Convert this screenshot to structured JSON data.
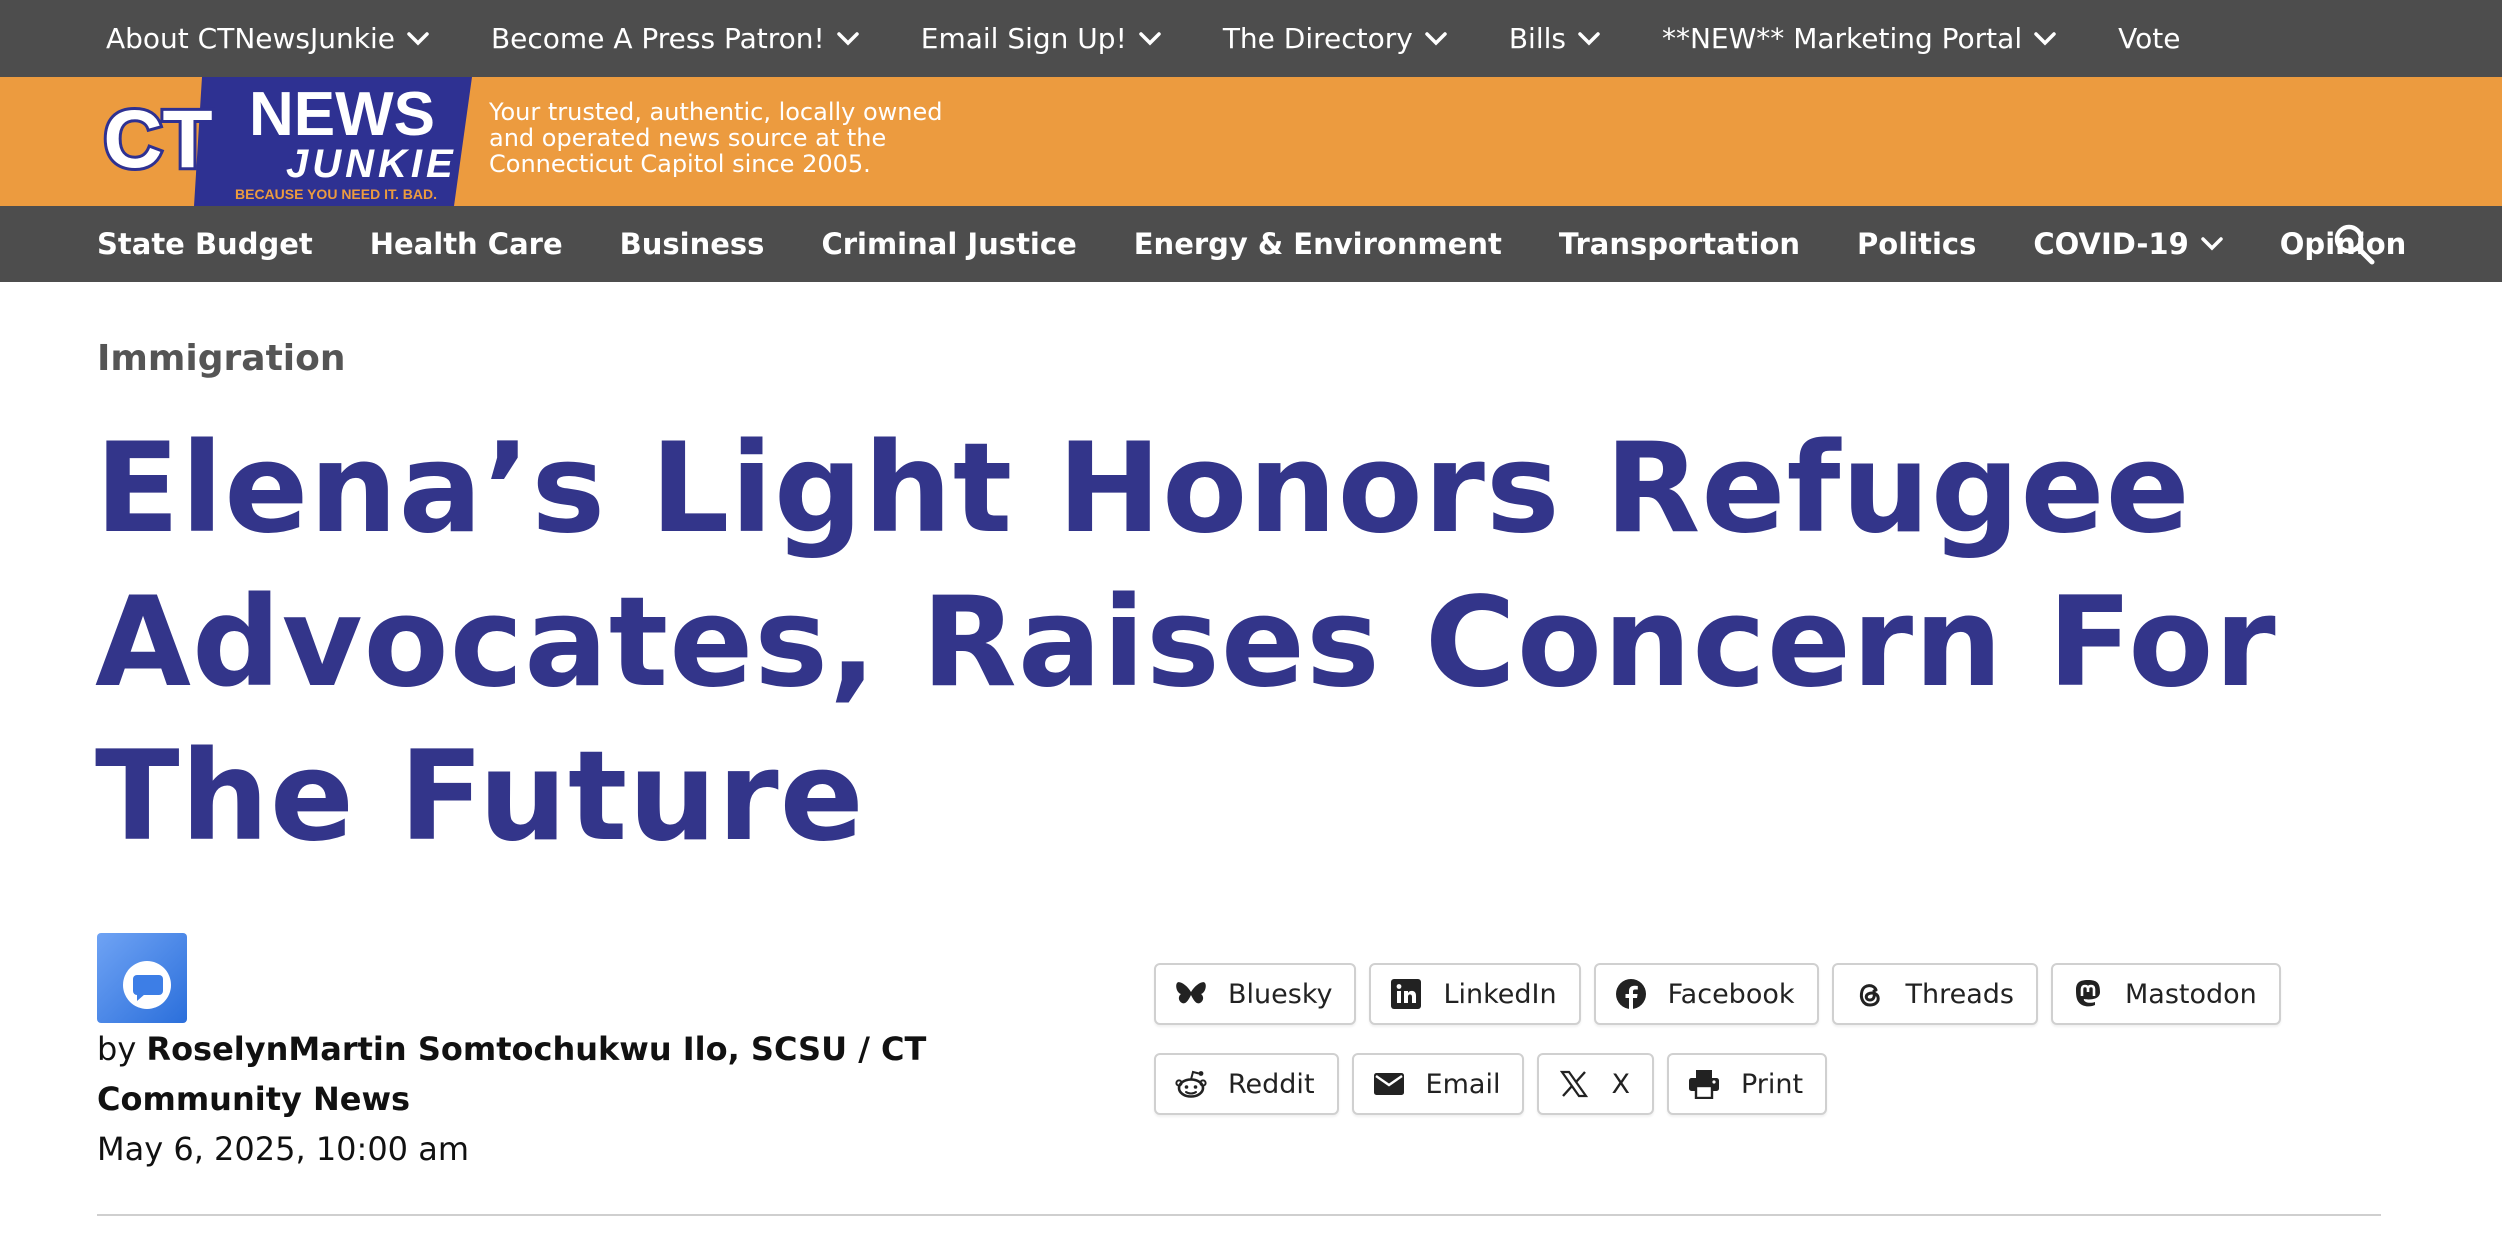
{
  "top_nav": {
    "items": [
      {
        "label": "About CTNewsJunkie",
        "has_dropdown": true
      },
      {
        "label": "Become A Press Patron!",
        "has_dropdown": true
      },
      {
        "label": "Email Sign Up!",
        "has_dropdown": true
      },
      {
        "label": "The Directory",
        "has_dropdown": true
      },
      {
        "label": "Bills",
        "has_dropdown": true
      },
      {
        "label": "**NEW** Marketing Portal",
        "has_dropdown": true
      },
      {
        "label": "Vote",
        "has_dropdown": false
      }
    ]
  },
  "brand": {
    "logo_ct": "CT",
    "logo_news": "NEWS",
    "logo_junkie": "JUNKIE",
    "logo_slogan": "BECAUSE YOU NEED IT. BAD.",
    "tagline_line1": "Your trusted, authentic, locally owned",
    "tagline_line2": "and operated news source at the",
    "tagline_line3": "Connecticut Capitol since 2005."
  },
  "main_nav": {
    "items": [
      {
        "label": "State Budget"
      },
      {
        "label": "Health Care"
      },
      {
        "label": "Business"
      },
      {
        "label": "Criminal Justice"
      },
      {
        "label": "Energy & Environment"
      },
      {
        "label": "Transportation"
      },
      {
        "label": "Politics"
      },
      {
        "label": "COVID-19"
      },
      {
        "label": "Opinion"
      }
    ]
  },
  "article": {
    "category": "Immigration",
    "headline": "Elena’s Light Honors Refugee Advocates, Raises Concern For The Future",
    "by_prefix": "by",
    "author": "RoselynMartin Somtochukwu Ilo, SCSU / CT Community News",
    "date": "May 6, 2025, 10:00 am"
  },
  "share": {
    "buttons": [
      {
        "label": "Bluesky",
        "icon": "butterfly-icon"
      },
      {
        "label": "LinkedIn",
        "icon": "linkedin-icon"
      },
      {
        "label": "Facebook",
        "icon": "facebook-icon"
      },
      {
        "label": "Threads",
        "icon": "threads-icon"
      },
      {
        "label": "Mastodon",
        "icon": "mastodon-icon"
      },
      {
        "label": "Reddit",
        "icon": "reddit-icon"
      },
      {
        "label": "Email",
        "icon": "envelope-icon"
      },
      {
        "label": "X",
        "icon": "x-icon"
      },
      {
        "label": "Print",
        "icon": "printer-icon"
      }
    ]
  },
  "colors": {
    "nav_bg": "#4d4d4d",
    "brand_orange": "#ec9b3f",
    "logo_navy": "#2e3192",
    "headline": "#33358a",
    "category": "#555555"
  }
}
